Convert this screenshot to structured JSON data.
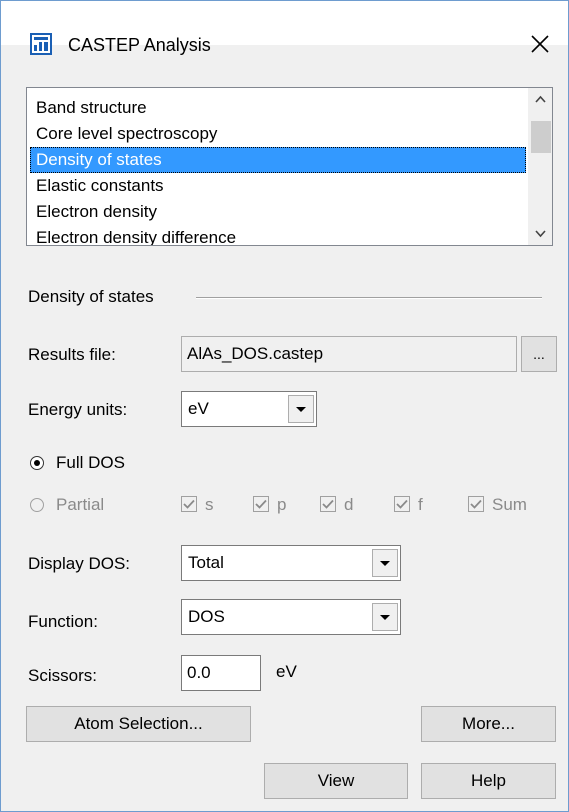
{
  "window": {
    "title": "CASTEP Analysis",
    "accent_color": "#1a5fb4"
  },
  "listbox": {
    "items": [
      "Band structure",
      "Core level spectroscopy",
      "Density of states",
      "Elastic constants",
      "Electron density",
      "Electron density difference"
    ],
    "selected": "Density of states",
    "selection_color": "#3399ff"
  },
  "group": {
    "title": "Density of states"
  },
  "results_file": {
    "label": "Results file:",
    "value": "AlAs_DOS.castep",
    "browse_label": "..."
  },
  "energy_units": {
    "label": "Energy units:",
    "value": "eV"
  },
  "dos_mode": {
    "full_label": "Full DOS",
    "full_checked": true,
    "partial_label": "Partial",
    "partial_checked": false,
    "partial_enabled": false,
    "orbitals": [
      {
        "label": "s",
        "checked": true
      },
      {
        "label": "p",
        "checked": true
      },
      {
        "label": "d",
        "checked": true
      },
      {
        "label": "f",
        "checked": true
      },
      {
        "label": "Sum",
        "checked": true
      }
    ]
  },
  "display_dos": {
    "label": "Display DOS:",
    "value": "Total"
  },
  "function": {
    "label": "Function:",
    "value": "DOS"
  },
  "scissors": {
    "label": "Scissors:",
    "value": "0.0",
    "unit": "eV"
  },
  "buttons": {
    "atom_selection": "Atom Selection...",
    "more": "More...",
    "view": "View",
    "help": "Help"
  }
}
